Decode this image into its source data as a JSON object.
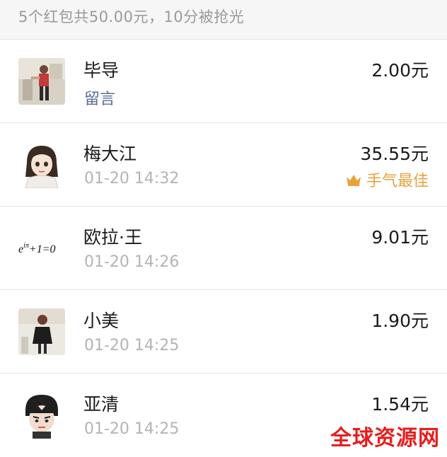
{
  "summary": {
    "text": "5个红包共50.00元，10分被抢光"
  },
  "rows": [
    {
      "name": "毕导",
      "sub": "留言",
      "amount": "2.00元",
      "avatar_icon": "photo-person-avatar-icon"
    },
    {
      "name": "梅大江",
      "sub": "01-20 14:32",
      "amount": "35.55元",
      "badge": "手气最佳",
      "avatar_icon": "cartoon-girl-avatar-icon"
    },
    {
      "name": "欧拉·王",
      "sub": "01-20 14:26",
      "amount": "9.01元",
      "avatar_formula": "e^{iπ}+1=0",
      "avatar_icon": "euler-formula-avatar-icon"
    },
    {
      "name": "小美",
      "sub": "01-20 14:25",
      "amount": "1.90元",
      "avatar_icon": "photo-girl-avatar-icon"
    },
    {
      "name": "亚清",
      "sub": "01-20 14:25",
      "amount": "1.54元",
      "avatar_icon": "cartoon-boy-avatar-icon"
    }
  ],
  "watermark": "全球资源网",
  "colors": {
    "link": "#5a6d96",
    "best": "#e8a33d",
    "watermark": "#e51e1e"
  }
}
